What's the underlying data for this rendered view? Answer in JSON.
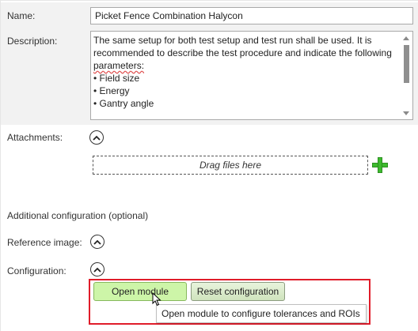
{
  "form": {
    "name_label": "Name:",
    "name_value": "Picket Fence Combination Halycon",
    "description_label": "Description:",
    "description_line1": "The same setup for both test setup and test run shall be used. It is recommended to describe the test procedure and indicate the following ",
    "description_parameters_word": "parameters:",
    "description_bullets": [
      "• Field size",
      "• Energy",
      "• Gantry angle"
    ],
    "attachments_label": "Attachments:",
    "dropzone_text": "Drag files here",
    "additional_config_heading": "Additional configuration (optional)",
    "reference_image_label": "Reference image:",
    "configuration_label": "Configuration:"
  },
  "buttons": {
    "open_module": "Open module",
    "reset_configuration": "Reset configuration"
  },
  "tooltip": {
    "text": "Open module to configure tolerances and ROIs"
  },
  "icons": {
    "collapse": "chevron-up-icon",
    "add": "plus-icon",
    "cursor": "mouse-pointer-icon"
  },
  "colors": {
    "highlight_border": "#e01c2a",
    "open_button_bg": "#cdf5a8",
    "add_icon": "#3dbb2e"
  }
}
